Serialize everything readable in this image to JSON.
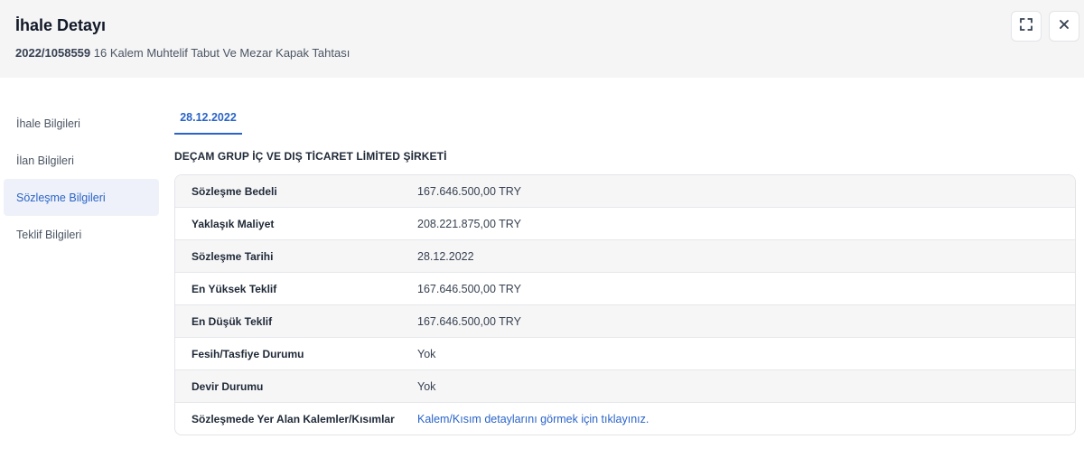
{
  "header": {
    "title": "İhale Detayı",
    "ikn": "2022/1058559",
    "description": "16 Kalem Muhtelif Tabut Ve Mezar Kapak Tahtası",
    "expand_icon": "expand-icon",
    "close_icon": "close-icon"
  },
  "sidebar": {
    "items": [
      {
        "label": "İhale Bilgileri"
      },
      {
        "label": "İlan Bilgileri"
      },
      {
        "label": "Sözleşme Bilgileri"
      },
      {
        "label": "Teklif Bilgileri"
      }
    ],
    "active_index": 2
  },
  "tabs": [
    {
      "label": "28.12.2022"
    }
  ],
  "company": "DEÇAM GRUP İÇ VE DIŞ TİCARET LİMİTED ŞİRKETİ",
  "details": {
    "rows": [
      {
        "label": "Sözleşme Bedeli",
        "value": "167.646.500,00 TRY"
      },
      {
        "label": "Yaklaşık Maliyet",
        "value": "208.221.875,00 TRY"
      },
      {
        "label": "Sözleşme Tarihi",
        "value": "28.12.2022"
      },
      {
        "label": "En Yüksek Teklif",
        "value": "167.646.500,00 TRY"
      },
      {
        "label": "En Düşük Teklif",
        "value": "167.646.500,00 TRY"
      },
      {
        "label": "Fesih/Tasfiye Durumu",
        "value": "Yok"
      },
      {
        "label": "Devir Durumu",
        "value": "Yok"
      },
      {
        "label": "Sözleşmede Yer Alan Kalemler/Kısımlar",
        "value": "Kalem/Kısım detaylarını görmek için tıklayınız."
      }
    ]
  },
  "colors": {
    "accent": "#2a64c8",
    "header_bg": "#f5f5f6",
    "active_bg": "#eef1f9",
    "row_shade": "#f6f6f7"
  }
}
